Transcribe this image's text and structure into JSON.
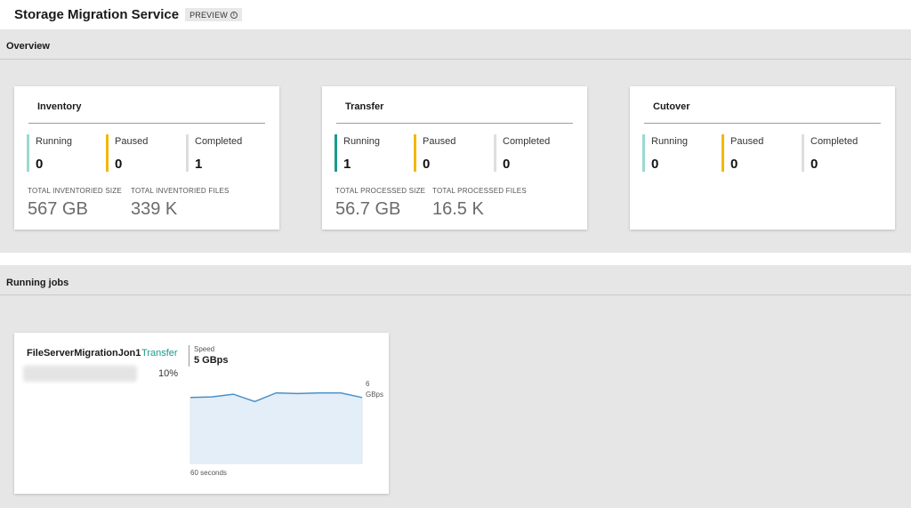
{
  "app": {
    "title": "Storage Migration Service",
    "badge": "PREVIEW",
    "badge_icon": "info-icon"
  },
  "overview": {
    "heading": "Overview",
    "cards": [
      {
        "title": "Inventory",
        "stats": [
          {
            "label": "Running",
            "value": "0",
            "color": "#9ad9d2"
          },
          {
            "label": "Paused",
            "value": "0",
            "color": "#f2b80d"
          },
          {
            "label": "Completed",
            "value": "1",
            "color": "#dedede"
          }
        ],
        "totals": [
          {
            "label": "TOTAL INVENTORIED SIZE",
            "value": "567 GB"
          },
          {
            "label": "TOTAL INVENTORIED FILES",
            "value": "339 K"
          }
        ]
      },
      {
        "title": "Transfer",
        "stats": [
          {
            "label": "Running",
            "value": "1",
            "color": "#1a9a8f"
          },
          {
            "label": "Paused",
            "value": "0",
            "color": "#f2b80d"
          },
          {
            "label": "Completed",
            "value": "0",
            "color": "#dedede"
          }
        ],
        "totals": [
          {
            "label": "TOTAL PROCESSED SIZE",
            "value": "56.7 GB"
          },
          {
            "label": "TOTAL PROCESSED FILES",
            "value": "16.5 K"
          }
        ]
      },
      {
        "title": "Cutover",
        "stats": [
          {
            "label": "Running",
            "value": "0",
            "color": "#9ad9d2"
          },
          {
            "label": "Paused",
            "value": "0",
            "color": "#f2b80d"
          },
          {
            "label": "Completed",
            "value": "0",
            "color": "#dedede"
          }
        ],
        "totals": []
      }
    ]
  },
  "running_jobs": {
    "heading": "Running jobs",
    "jobs": [
      {
        "name": "FileServerMigrationJon1",
        "type": "Transfer",
        "progress": "10%",
        "speed_label": "Speed",
        "speed_value": "5 GBps",
        "y_max_value": "6",
        "y_max_unit": "GBps",
        "x_span_label": "60 seconds"
      }
    ]
  },
  "chart_data": {
    "type": "area",
    "x_span": "60 seconds",
    "ylim": [
      0,
      6
    ],
    "y_unit": "GBps",
    "values": [
      5.0,
      5.05,
      5.25,
      4.7,
      5.35,
      5.3,
      5.35,
      5.35,
      5.0
    ],
    "line_color": "#4a90c8",
    "fill_color": "#e3eef8"
  }
}
